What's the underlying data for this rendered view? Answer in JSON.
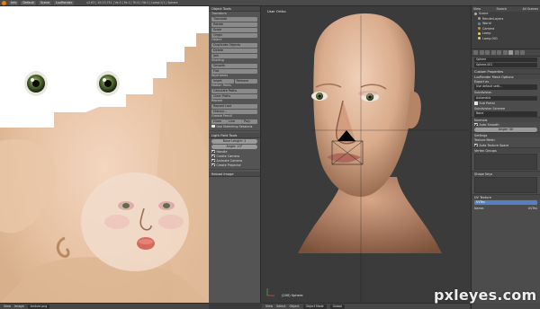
{
  "topbar": {
    "editor_type": "Info",
    "screen": "Default",
    "scene": "Scene",
    "engine": "LuxRender",
    "stats": "v2.63 | 10:13.751 | Ve:3 | Fa:1 | Tri:4 | Ob:1 | Lamp:1/1 | Sphere"
  },
  "uv_editor": {
    "header": {
      "view": "View",
      "image": "Image",
      "image_name": "texture.png"
    }
  },
  "toolshelf": {
    "title": "Object Tools",
    "transform": {
      "label": "Transform",
      "buttons": [
        "Translate",
        "Rotate",
        "Scale",
        "Origin"
      ]
    },
    "object": {
      "label": "Object",
      "buttons": [
        "Duplicate Objects",
        "Delete",
        "Join"
      ]
    },
    "shading": {
      "label": "Shading",
      "buttons": [
        "Smooth",
        "Flat"
      ]
    },
    "keyframes": {
      "label": "Keyframes",
      "buttons": [
        "Insert",
        "Remove"
      ]
    },
    "motion_paths": {
      "label": "Motion Paths",
      "buttons": [
        "Calculate Paths",
        "Clear Paths"
      ]
    },
    "repeat": {
      "label": "Repeat",
      "buttons": [
        "Repeat Last",
        "History..."
      ]
    },
    "grease_pencil": {
      "label": "Grease Pencil",
      "buttons": [
        "Draw",
        "Line",
        "Poly"
      ],
      "checkbox": "Use Sketching Sessions"
    },
    "light_field": {
      "title": "Light Field Tools",
      "base_length": "Base Length: 1",
      "angle": "Angle: 10°",
      "checks": [
        "Handle",
        "Create Camera",
        "Animate Camera",
        "Create Projector"
      ]
    },
    "last_op": "Reload Image"
  },
  "viewport": {
    "label": "User Ortho",
    "object_label": "(200) Sphere",
    "header": {
      "view": "View",
      "select": "Select",
      "object": "Object",
      "mode": "Object Mode",
      "pivot": "Global"
    }
  },
  "properties": {
    "outliner": {
      "view": "View",
      "search": "Search",
      "scenes": "All Scenes",
      "items": [
        {
          "name": "Scene",
          "color": "#b0b0b0"
        },
        {
          "name": "RenderLayers",
          "color": "#a0a0a0"
        },
        {
          "name": "World",
          "color": "#4b8cd9"
        },
        {
          "name": "Camera",
          "color": "#d08a3a"
        },
        {
          "name": "Lamp",
          "color": "#e6d05c"
        },
        {
          "name": "Lamp.001",
          "color": "#e6d05c"
        }
      ]
    },
    "object_name": "Sphere",
    "mesh_name": "Sphere.001",
    "custom_properties": "Custom Properties",
    "lux_mesh": "LuxRender Mesh Options",
    "export_as": "Export as",
    "export_value": "Use default setti...",
    "subdivision": "Subdivision",
    "subdivision_value": "Automatic",
    "sub_portal": "Sub Portal",
    "displacement": "Subdivision Scheme",
    "displacement_value": "None",
    "normals": "Normals",
    "auto_smooth": "Auto Smooth",
    "angle": "Angle: 30",
    "settings": "Settings",
    "texture_mesh": "Texture Mesh:",
    "auto_texture": "Auto Texture Space",
    "vertex_groups": "Vertex Groups",
    "shape_keys": "Shape Keys",
    "uv_texture": "UV Texture",
    "uv_name": "UVTex",
    "name_label": "Name:",
    "name_value": "UVTex"
  },
  "watermark": "pxleyes.com"
}
